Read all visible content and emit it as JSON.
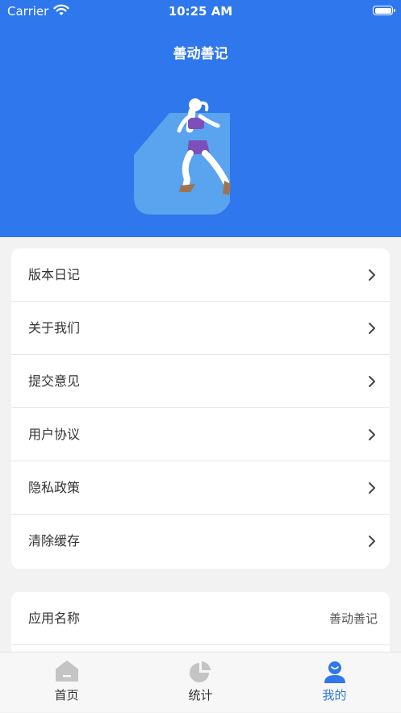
{
  "status_bar": {
    "carrier": "Carrier",
    "time": "10:25 AM"
  },
  "header": {
    "title": "善动善记"
  },
  "menu": {
    "items": [
      {
        "label": "版本日记"
      },
      {
        "label": "关于我们"
      },
      {
        "label": "提交意见"
      },
      {
        "label": "用户协议"
      },
      {
        "label": "隐私政策"
      },
      {
        "label": "清除缓存"
      }
    ]
  },
  "info": {
    "app_name_label": "应用名称",
    "app_name_value": "善动善记"
  },
  "tabbar": {
    "tabs": [
      {
        "label": "首页",
        "icon": "home-icon"
      },
      {
        "label": "统计",
        "icon": "pie-chart-icon"
      },
      {
        "label": "我的",
        "icon": "user-icon"
      }
    ],
    "active_index": 2
  },
  "colors": {
    "primary": "#2f77ec",
    "background": "#f2f2f2",
    "hero_shape": "#5aa3ef",
    "runner_outfit": "#7d4fb8",
    "inactive_icon": "#c4c4c4"
  }
}
